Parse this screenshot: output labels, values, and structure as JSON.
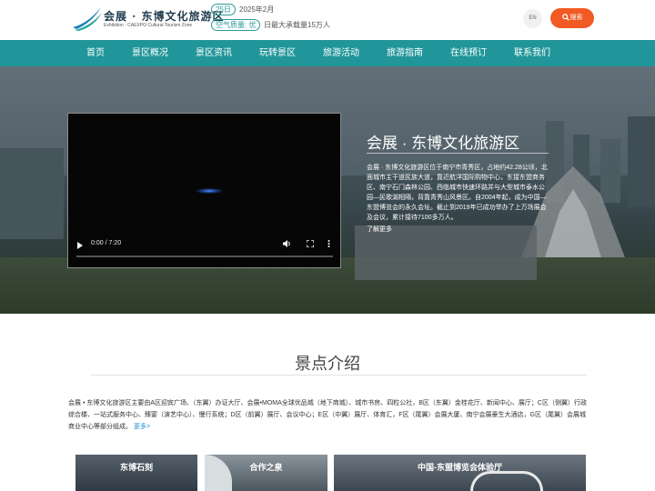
{
  "header": {
    "logo_title": "会展 · 东博文化旅游区",
    "logo_sub": "Exhibition · CAEXPO Cultural Tourism Zone",
    "date_badge": "25日",
    "date_text": "2025年2月",
    "air_badge": "空气质量: 优",
    "capacity_text": "日最大承载量15万人",
    "lang_label": "EN",
    "search_label": "搜索"
  },
  "nav": {
    "items": [
      {
        "label": "首页"
      },
      {
        "label": "景区概况"
      },
      {
        "label": "景区资讯"
      },
      {
        "label": "玩转景区"
      },
      {
        "label": "旅游活动"
      },
      {
        "label": "旅游指南"
      },
      {
        "label": "在线预订"
      },
      {
        "label": "联系我们"
      }
    ]
  },
  "hero": {
    "video_time": "0:00 / 7:20",
    "title": "会展 · 东博文化旅游区",
    "desc": "会展 · 东博文化旅游区位于南宁市青秀区，占地约42.28公顷，北面城市主干道民族大道，靠近航洋国际购物中心，东接东盟商务区、南宁石门森林公园、西临城市快速环路并与大型城市泰水公园—民歌湖相隔，背靠青秀山风景区。自2004年起，成为中国—东盟博览会的永久会址。截止到2019年已成功举办了上万场展会及会议，累计接待7100多万人。",
    "more": "了解更多"
  },
  "section": {
    "title": "景点介绍",
    "text": "会展 • 东博文化旅游区主要由A区迎宾广场、（东翼）办证大厅、会展•MOMA全球优品城（地下商城）、城市书房、四粒公社，B区（东翼）金桂花厅、新闻中心、展厅；C区（侧翼）行政综合楼、一站式服务中心、臻宴（演艺中心）、慢行系统；D区（前翼）展厅、会议中心；E区（中翼）展厅、体育汇，F区（尾翼）会展大厦、南宁会展豪生大酒店，G区（尾翼）会展城商业中心等部分组成。",
    "more": "更多>",
    "cards": [
      {
        "label": "东博石刻"
      },
      {
        "label": "合作之泉"
      },
      {
        "label": "中国-东盟博览会体验厅"
      }
    ]
  },
  "colors": {
    "nav_bg": "#21969a",
    "accent_orange": "#f15a24",
    "badge_teal": "#2a9a9a",
    "link_blue": "#1a8fd6"
  },
  "icons": [
    "logo-swoosh-icon",
    "search-icon",
    "play-icon",
    "volume-icon",
    "fullscreen-icon",
    "more-vert-icon"
  ]
}
